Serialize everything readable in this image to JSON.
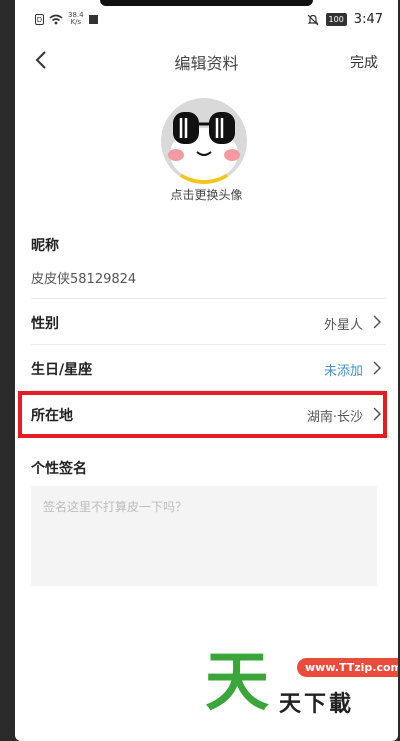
{
  "status_bar": {
    "sim_label": "D",
    "net_speed_value": "38.4",
    "net_speed_unit": "K/s",
    "battery": "100",
    "time": "3:47"
  },
  "header": {
    "title": "编辑资料",
    "done_label": "完成"
  },
  "avatar": {
    "caption": "点击更换头像"
  },
  "nickname": {
    "label": "昵称",
    "value": "皮皮侠58129824"
  },
  "rows": [
    {
      "label": "性别",
      "value": "外星人"
    },
    {
      "label": "生日/星座",
      "value": "未添加"
    },
    {
      "label": "所在地",
      "value": "湖南·长沙"
    }
  ],
  "signature": {
    "label": "个性签名",
    "placeholder": "签名这里不打算皮一下吗？"
  },
  "watermark": {
    "big_char": "天",
    "url": "www.TTzip.com",
    "text": "天下載"
  },
  "colors": {
    "highlight": "#e51c23",
    "accent_blue": "#4a90c8",
    "watermark_green": "#3aa539",
    "watermark_red": "#e94b3c"
  }
}
